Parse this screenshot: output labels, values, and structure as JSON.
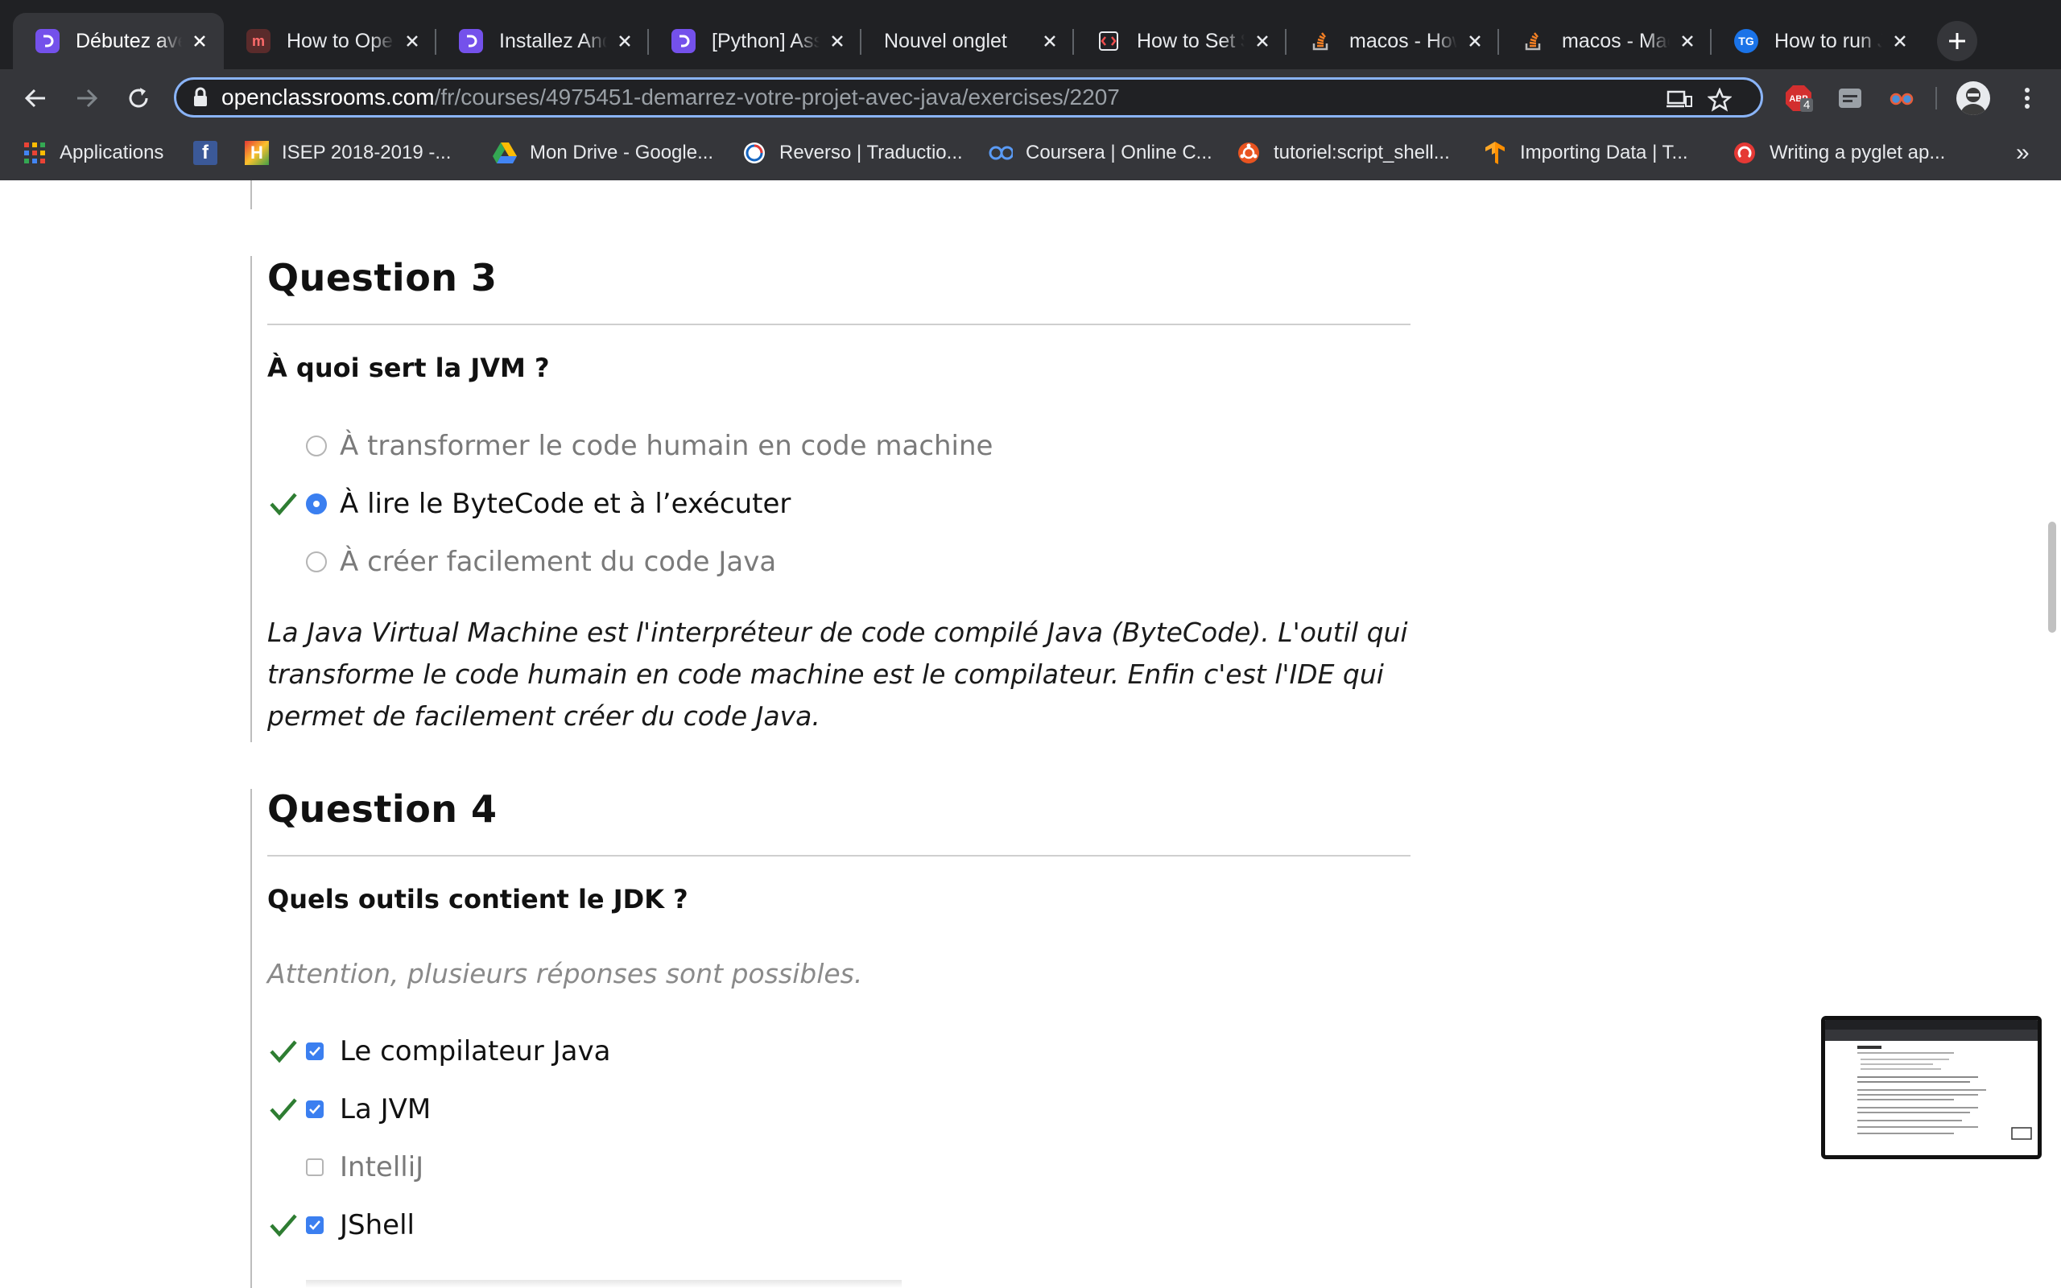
{
  "browser": {
    "tabs": [
      {
        "title": "Débutez ave",
        "icon": "openclassrooms-icon",
        "active": true
      },
      {
        "title": "How to Oper",
        "icon": "medium-icon",
        "active": false
      },
      {
        "title": "Installez And",
        "icon": "openclassrooms-icon",
        "active": false
      },
      {
        "title": "[Python] Ass",
        "icon": "openclassrooms-icon",
        "active": false
      },
      {
        "title": "Nouvel onglet",
        "icon": "",
        "active": false
      },
      {
        "title": "How to Set $",
        "icon": "code-icon",
        "active": false
      },
      {
        "title": "macos - How",
        "icon": "stackoverflow-icon",
        "active": false
      },
      {
        "title": "macos - Mac",
        "icon": "stackoverflow-icon",
        "active": false
      },
      {
        "title": "How to run J",
        "icon": "tg-icon",
        "active": false
      }
    ],
    "tg_badge": "TG",
    "url_host": "openclassrooms.com",
    "url_path": "/fr/courses/4975451-demarrez-votre-projet-avec-java/exercises/2207",
    "ext_badge": "4",
    "ext_abp": "ABP",
    "bookmarks": [
      {
        "label": "Applications",
        "icon": "apps-grid-icon"
      },
      {
        "label": "",
        "icon": "facebook-icon"
      },
      {
        "label": "ISEP 2018-2019 -...",
        "icon": "isep-icon"
      },
      {
        "label": "Mon Drive - Google...",
        "icon": "google-drive-icon"
      },
      {
        "label": "Reverso | Traductio...",
        "icon": "reverso-icon"
      },
      {
        "label": "Coursera | Online C...",
        "icon": "coursera-icon"
      },
      {
        "label": "tutoriel:script_shell...",
        "icon": "ubuntu-icon"
      },
      {
        "label": "Importing Data  |  T...",
        "icon": "tensorflow-icon"
      },
      {
        "label": "Writing a pyglet ap...",
        "icon": "pyglet-icon"
      }
    ],
    "more_bookmarks": "»"
  },
  "quiz": {
    "q3": {
      "title": "Question 3",
      "prompt": "À quoi sert la JVM ?",
      "options": [
        {
          "label": "À transformer le code humain en code machine",
          "selected": false,
          "correct": false
        },
        {
          "label": "À lire le ByteCode et à l’exécuter",
          "selected": true,
          "correct": true
        },
        {
          "label": "À créer facilement du code Java",
          "selected": false,
          "correct": false
        }
      ],
      "explanation_lines": [
        "La Java Virtual Machine est l'interpréteur de code compilé Java (ByteCode). L'outil qui",
        "transforme le code humain en code machine est le compilateur. Enfin c'est l'IDE qui",
        "permet de facilement créer du code Java."
      ]
    },
    "q4": {
      "title": "Question 4",
      "prompt": "Quels outils contient le JDK ?",
      "hint": "Attention, plusieurs réponses sont possibles.",
      "options": [
        {
          "label": "Le compilateur Java",
          "selected": true,
          "correct": true
        },
        {
          "label": "La JVM",
          "selected": true,
          "correct": true
        },
        {
          "label": "IntelliJ",
          "selected": false,
          "correct": false
        },
        {
          "label": "JShell",
          "selected": true,
          "correct": true
        }
      ]
    }
  },
  "colors": {
    "accent_blue": "#3b7ff0",
    "check_green": "#2e7d32",
    "chrome_dark": "#202124",
    "chrome_toolbar": "#35363a",
    "oc_purple": "#7451eb"
  }
}
